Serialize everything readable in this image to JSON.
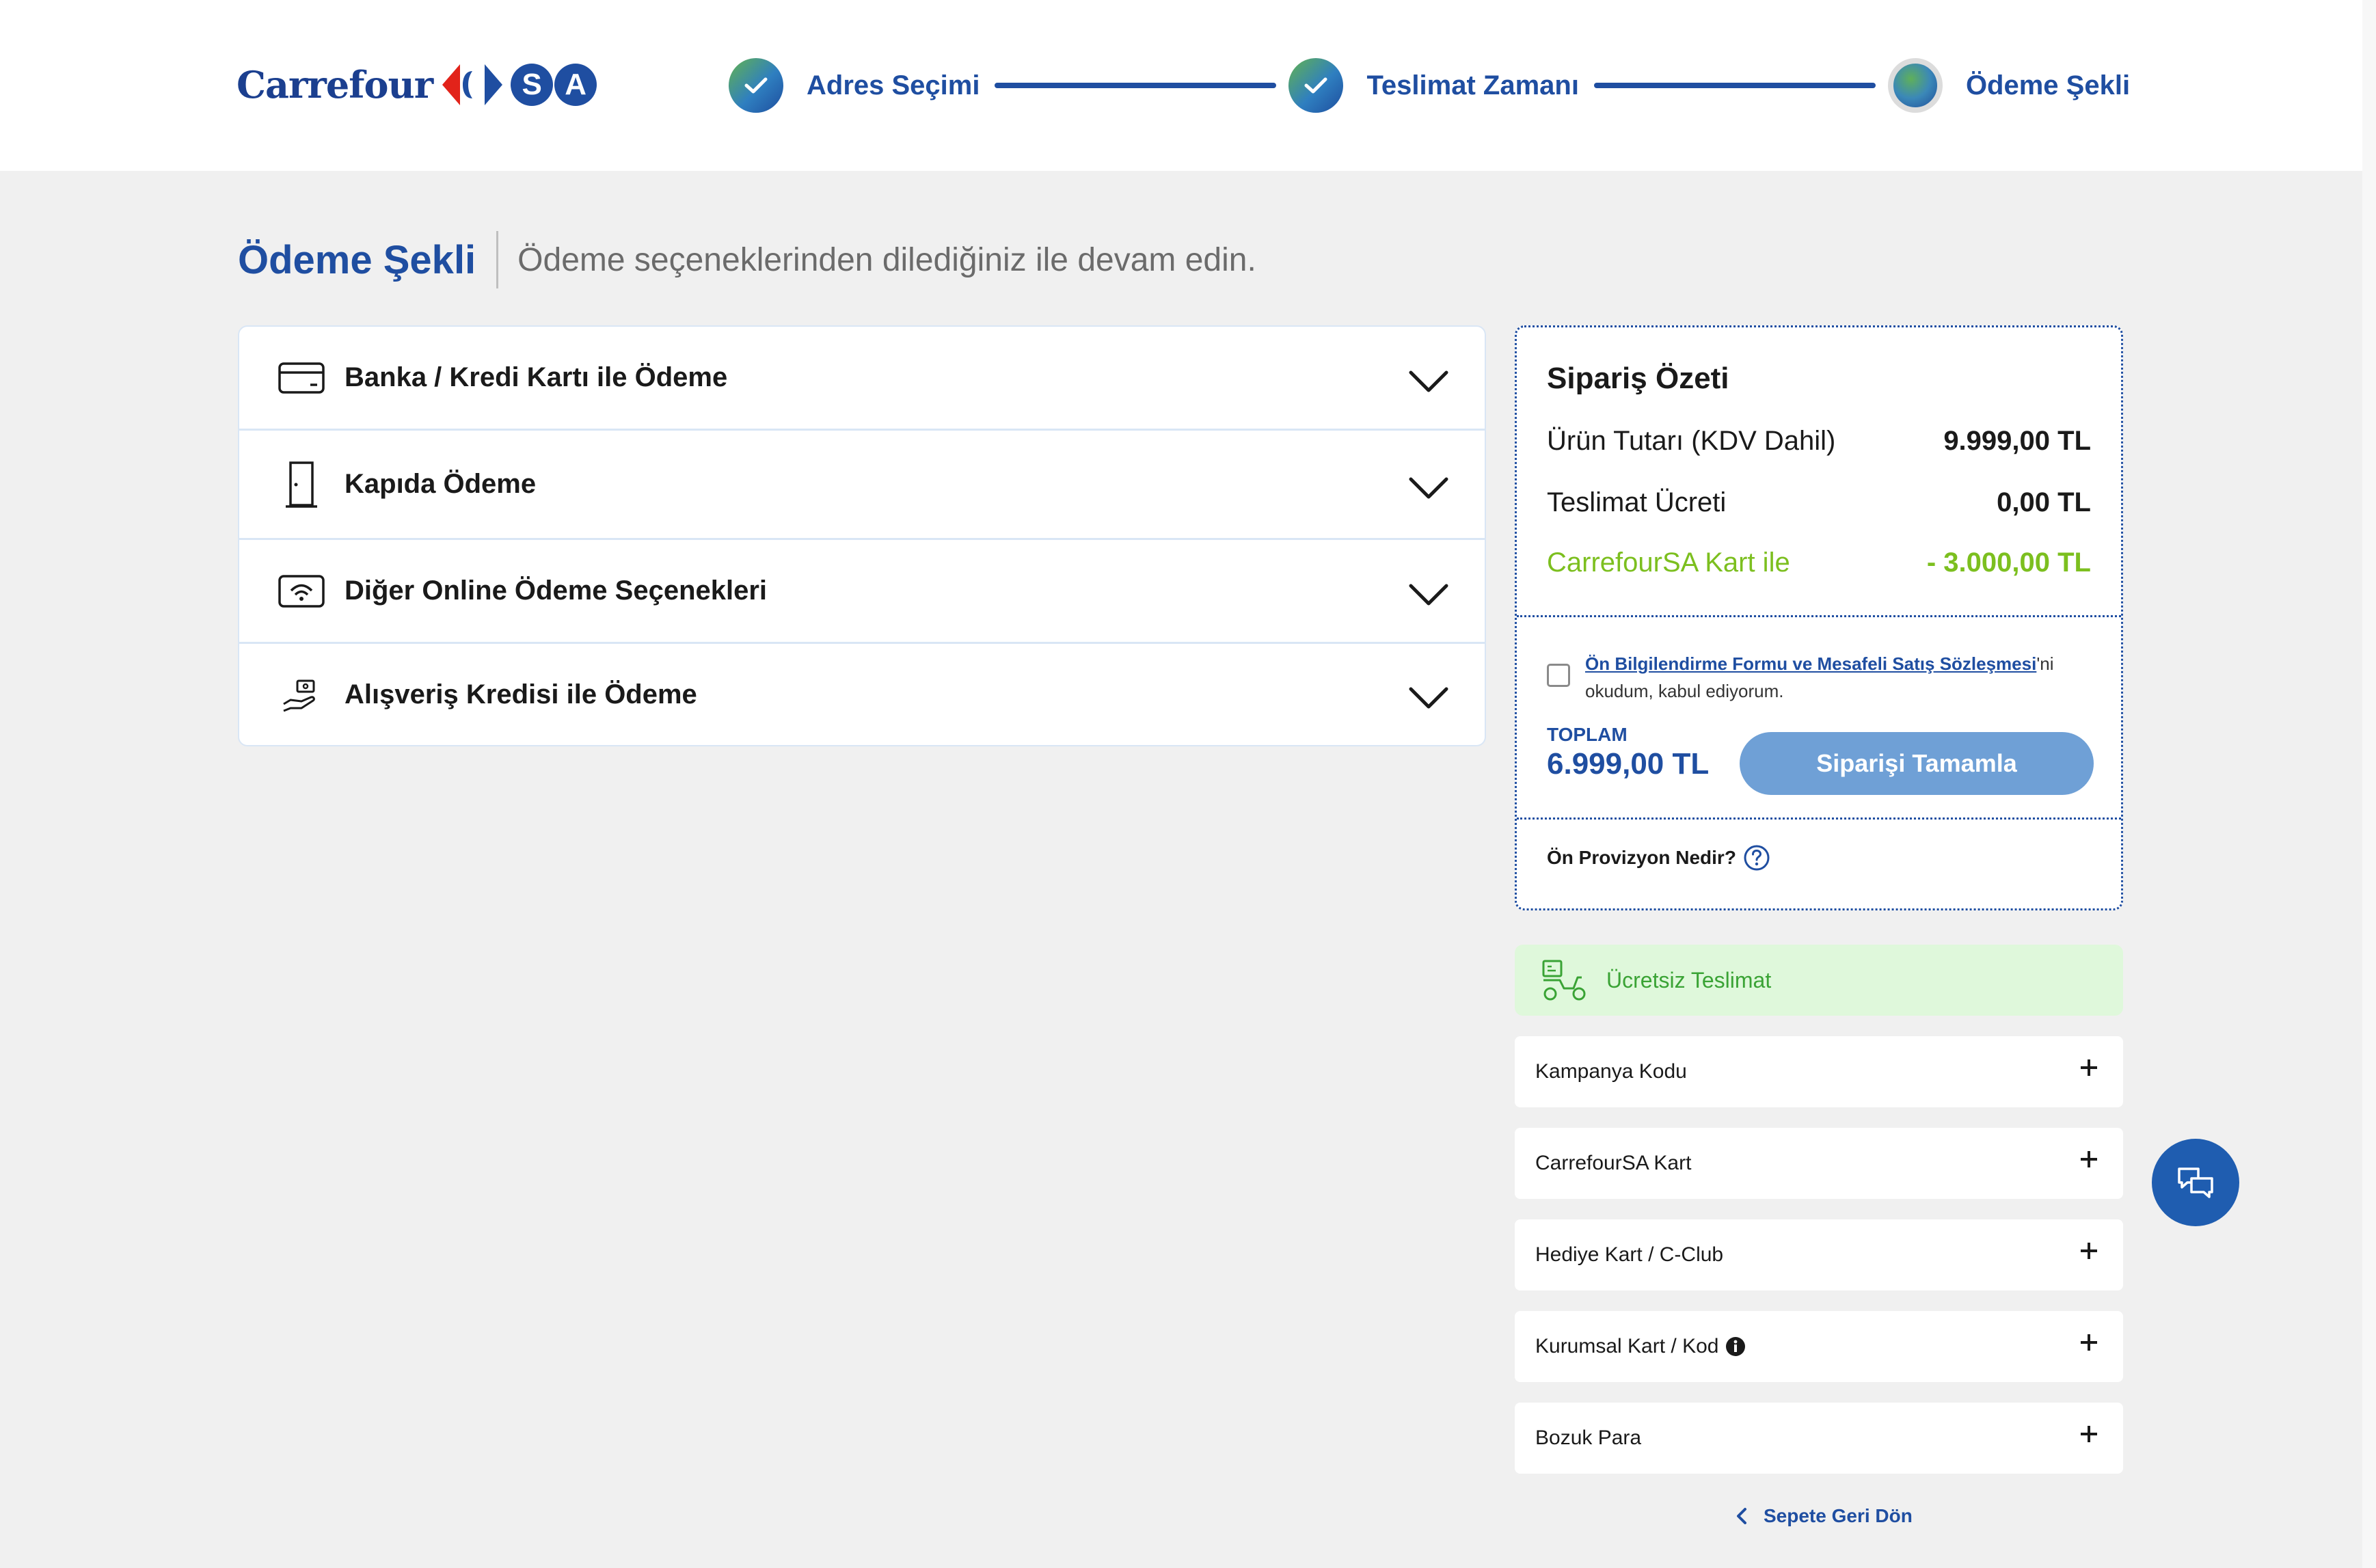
{
  "header": {
    "logo": {
      "brand": "Carrefour",
      "suffix": "SA"
    },
    "steps": [
      {
        "label": "Adres Seçimi",
        "state": "done"
      },
      {
        "label": "Teslimat Zamanı",
        "state": "done"
      },
      {
        "label": "Ödeme Şekli",
        "state": "current"
      }
    ]
  },
  "page": {
    "title": "Ödeme Şekli",
    "subtitle": "Ödeme seçeneklerinden dilediğiniz ile devam edin."
  },
  "payment_methods": [
    {
      "label": "Banka / Kredi Kartı ile Ödeme",
      "icon": "credit-card-icon"
    },
    {
      "label": "Kapıda Ödeme",
      "icon": "door-icon"
    },
    {
      "label": "Diğer Online Ödeme Seçenekleri",
      "icon": "contactless-card-icon"
    },
    {
      "label": "Alışveriş Kredisi ile Ödeme",
      "icon": "hand-money-icon"
    }
  ],
  "summary": {
    "title": "Sipariş Özeti",
    "rows": [
      {
        "label": "Ürün Tutarı (KDV Dahil)",
        "value": "9.999,00 TL"
      },
      {
        "label": "Teslimat Ücreti",
        "value": "0,00 TL"
      },
      {
        "label": "CarrefourSA Kart ile",
        "value": "- 3.000,00 TL"
      }
    ],
    "agreement": {
      "link_text": "Ön Bilgilendirme Formu ve Mesafeli Satış Sözleşmesi",
      "rest_text": "'ni okudum, kabul ediyorum.",
      "checked": false
    },
    "total_label": "TOPLAM",
    "total_value": "6.999,00 TL",
    "complete_button": "Siparişi Tamamla",
    "provizyon_label": "Ön Provizyon Nedir?"
  },
  "free_delivery": {
    "label": "Ücretsiz Teslimat",
    "icon": "delivery-scooter-icon"
  },
  "accordions": [
    {
      "label": "Kampanya Kodu"
    },
    {
      "label": "CarrefourSA Kart"
    },
    {
      "label": "Hediye Kart / C-Club"
    },
    {
      "label": "Kurumsal Kart / Kod",
      "info_icon": "info-icon"
    },
    {
      "label": "Bozuk Para"
    }
  ],
  "back_link": "Sepete Geri Dön",
  "colors": {
    "primary": "#1f4ea1",
    "discount_green": "#7cbf1f",
    "delivery_green": "#3aa335",
    "button_blue": "#6fa0d6",
    "background": "#f0f0f0"
  }
}
